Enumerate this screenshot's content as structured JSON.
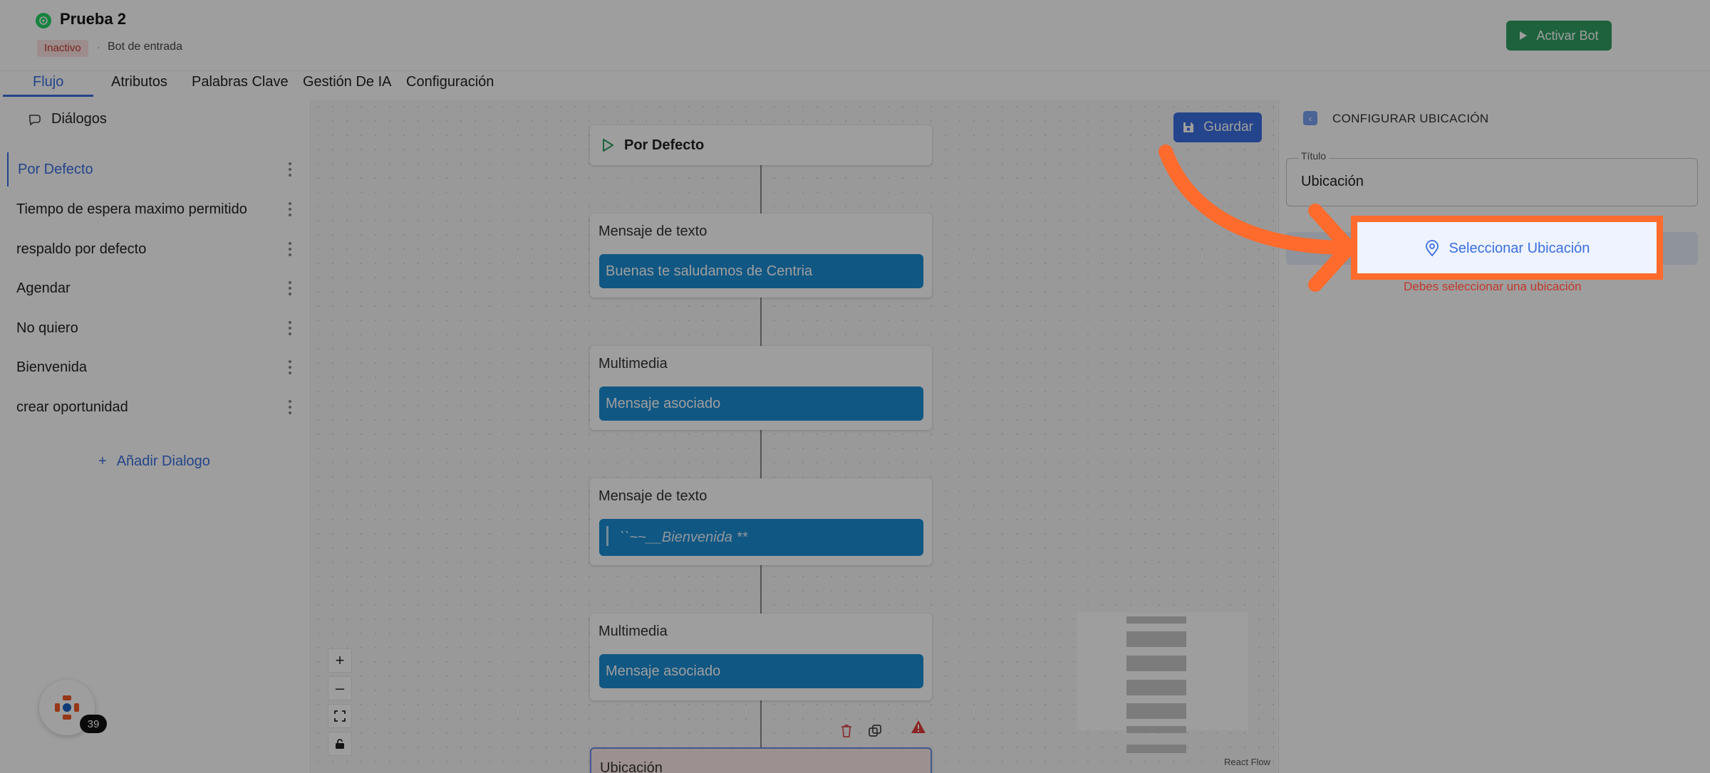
{
  "header": {
    "title": "Prueba 2",
    "status_badge": "Inactivo",
    "separator": "·",
    "bot_type": "Bot de entrada",
    "activate_label": "Activar Bot"
  },
  "tabs": [
    {
      "label": "Flujo",
      "active": true
    },
    {
      "label": "Atributos"
    },
    {
      "label": "Palabras Clave"
    },
    {
      "label": "Gestión De IA"
    },
    {
      "label": "Configuración"
    }
  ],
  "sidebar": {
    "title": "Diálogos",
    "items": [
      {
        "label": "Por Defecto",
        "active": true
      },
      {
        "label": "Tiempo de espera maximo permitido"
      },
      {
        "label": "respaldo por defecto"
      },
      {
        "label": "Agendar"
      },
      {
        "label": "No quiero"
      },
      {
        "label": "Bienvenida"
      },
      {
        "label": "crear oportunidad"
      }
    ],
    "add_label": "Añadir Dialogo"
  },
  "canvas": {
    "save_label": "Guardar",
    "start_node": "Por Defecto",
    "nodes": [
      {
        "label": "Mensaje de texto",
        "content": "Buenas te saludamos de Centria"
      },
      {
        "label": "Multimedia",
        "content": "Mensaje asociado"
      },
      {
        "label": "Mensaje de texto",
        "content": "``~~__Bienvenida **"
      },
      {
        "label": "Multimedia",
        "content": "Mensaje asociado"
      }
    ],
    "location_node": "Ubicación",
    "attribution": "React Flow",
    "zoom_in": "+",
    "zoom_out": "–"
  },
  "notifications": {
    "count": "39"
  },
  "panel": {
    "title": "CONFIGURAR UBICACIÓN",
    "field_label": "Título",
    "field_value": "Ubicación",
    "select_label": "Seleccionar Ubicación",
    "error": "Debes seleccionar una ubicación"
  },
  "colors": {
    "accent": "#3b6fe0",
    "activate": "#2f9e63",
    "node_pill": "#1b8dd4",
    "highlight": "#ff6b2c",
    "error": "#c0392b"
  }
}
